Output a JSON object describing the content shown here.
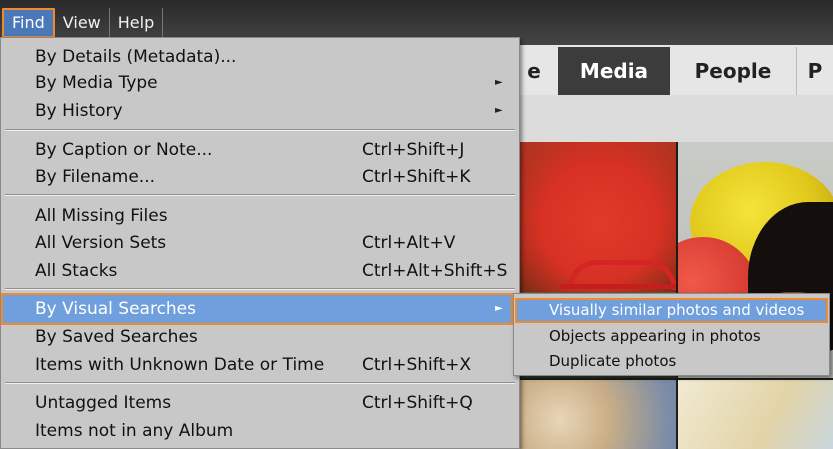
{
  "menubar": {
    "items": [
      "Find",
      "View",
      "Help"
    ]
  },
  "tabs": {
    "partial_left": "e",
    "items": [
      "Media",
      "People"
    ],
    "partial_right": "P"
  },
  "find_menu": {
    "groups": [
      [
        {
          "label": "By Details (Metadata)...",
          "shortcut": "",
          "submenu": false
        },
        {
          "label": "By Media Type",
          "shortcut": "",
          "submenu": true
        },
        {
          "label": "By History",
          "shortcut": "",
          "submenu": true
        }
      ],
      [
        {
          "label": "By Caption or Note...",
          "shortcut": "Ctrl+Shift+J",
          "submenu": false
        },
        {
          "label": "By Filename...",
          "shortcut": "Ctrl+Shift+K",
          "submenu": false
        }
      ],
      [
        {
          "label": "All Missing Files",
          "shortcut": "",
          "submenu": false
        },
        {
          "label": "All Version Sets",
          "shortcut": "Ctrl+Alt+V",
          "submenu": false
        },
        {
          "label": "All Stacks",
          "shortcut": "Ctrl+Alt+Shift+S",
          "submenu": false
        }
      ],
      [
        {
          "label": "By Visual Searches",
          "shortcut": "",
          "submenu": true,
          "highlighted": true
        },
        {
          "label": "By Saved Searches",
          "shortcut": "",
          "submenu": false
        },
        {
          "label": "Items with Unknown Date or Time",
          "shortcut": "Ctrl+Shift+X",
          "submenu": false
        }
      ],
      [
        {
          "label": "Untagged Items",
          "shortcut": "Ctrl+Shift+Q",
          "submenu": false
        },
        {
          "label": "Items not in any Album",
          "shortcut": "",
          "submenu": false
        }
      ]
    ]
  },
  "visual_search_submenu": {
    "items": [
      {
        "label": "Visually similar photos and videos",
        "highlighted": true
      },
      {
        "label": "Objects appearing in photos"
      },
      {
        "label": "Duplicate photos"
      }
    ]
  },
  "colors": {
    "highlight": "#6f9fdc",
    "focus_outline": "#f08a2a",
    "menu_bg": "#c8c8c8",
    "active_tab": "#3c3c3c"
  },
  "icons": {
    "submenu_arrow": "triangle-right-icon"
  }
}
